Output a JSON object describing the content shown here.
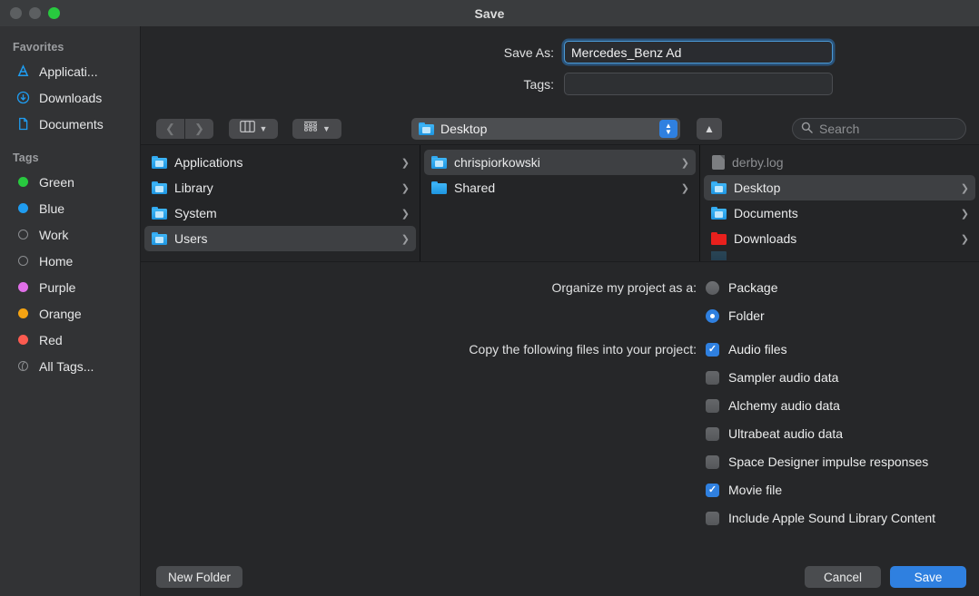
{
  "window": {
    "title": "Save",
    "traffic_lights": [
      "close",
      "minimize",
      "maximize"
    ]
  },
  "sidebar": {
    "favorites_heading": "Favorites",
    "favorites": [
      {
        "label": "Applicati...",
        "icon": "applications-icon"
      },
      {
        "label": "Downloads",
        "icon": "downloads-icon"
      },
      {
        "label": "Documents",
        "icon": "documents-icon"
      }
    ],
    "tags_heading": "Tags",
    "tags": [
      {
        "label": "Green",
        "color": "#28c93f",
        "style": "filled"
      },
      {
        "label": "Blue",
        "color": "#1f9cf0",
        "style": "filled"
      },
      {
        "label": "Work",
        "color": "",
        "style": "hollow"
      },
      {
        "label": "Home",
        "color": "",
        "style": "hollow"
      },
      {
        "label": "Purple",
        "color": "#e06fe8",
        "style": "filled"
      },
      {
        "label": "Orange",
        "color": "#f5a312",
        "style": "filled"
      },
      {
        "label": "Red",
        "color": "#fc5b50",
        "style": "filled"
      },
      {
        "label": "All Tags...",
        "color": "",
        "style": "alltags"
      }
    ]
  },
  "fields": {
    "save_as_label": "Save As:",
    "save_as_value": "Mercedes_Benz Ad",
    "tags_label": "Tags:",
    "tags_value": ""
  },
  "toolbar": {
    "back_icon": "chevron-left-icon",
    "forward_icon": "chevron-right-icon",
    "view_mode_icon": "column-view-icon",
    "group_icon": "group-items-icon",
    "path_label": "Desktop",
    "path_icon": "folder-icon",
    "stepper_icon": "up-down-stepper-icon",
    "up_icon": "chevron-up-icon",
    "search_placeholder": "Search",
    "search_icon": "search-icon"
  },
  "browser": {
    "columns": [
      {
        "items": [
          {
            "label": "Applications",
            "icon": "folder-blue",
            "selected": false,
            "dim": false,
            "arrow": true
          },
          {
            "label": "Library",
            "icon": "folder-blue",
            "selected": false,
            "dim": false,
            "arrow": true
          },
          {
            "label": "System",
            "icon": "folder-blue",
            "selected": false,
            "dim": false,
            "arrow": true
          },
          {
            "label": "Users",
            "icon": "folder-blue",
            "selected": true,
            "dim": false,
            "arrow": true
          }
        ]
      },
      {
        "items": [
          {
            "label": "chrispiorkowski",
            "icon": "folder-blue",
            "selected": true,
            "dim": false,
            "arrow": true
          },
          {
            "label": "Shared",
            "icon": "folder-blue",
            "selected": false,
            "dim": false,
            "arrow": true
          }
        ]
      },
      {
        "items": [
          {
            "label": "derby.log",
            "icon": "document",
            "selected": false,
            "dim": true,
            "arrow": false
          },
          {
            "label": "Desktop",
            "icon": "folder-blue",
            "selected": true,
            "dim": false,
            "arrow": true
          },
          {
            "label": "Documents",
            "icon": "folder-blue",
            "selected": false,
            "dim": false,
            "arrow": true
          },
          {
            "label": "Downloads",
            "icon": "folder-red",
            "selected": false,
            "dim": false,
            "arrow": true
          }
        ]
      }
    ]
  },
  "options": {
    "organize_label": "Organize my project as a:",
    "organize_choices": [
      {
        "label": "Package",
        "selected": false
      },
      {
        "label": "Folder",
        "selected": true
      }
    ],
    "copy_label": "Copy the following files into your project:",
    "copy_choices": [
      {
        "label": "Audio files",
        "checked": true
      },
      {
        "label": "Sampler audio data",
        "checked": false
      },
      {
        "label": "Alchemy audio data",
        "checked": false
      },
      {
        "label": "Ultrabeat audio data",
        "checked": false
      },
      {
        "label": "Space Designer impulse responses",
        "checked": false
      },
      {
        "label": "Movie file",
        "checked": true
      },
      {
        "label": "Include Apple Sound Library Content",
        "checked": false
      }
    ]
  },
  "footer": {
    "new_folder_label": "New Folder",
    "cancel_label": "Cancel",
    "save_label": "Save"
  },
  "colors": {
    "accent": "#2f80e0",
    "window_bg": "#262729",
    "sidebar_bg": "#323335",
    "titlebar_bg": "#3a3c3e"
  }
}
